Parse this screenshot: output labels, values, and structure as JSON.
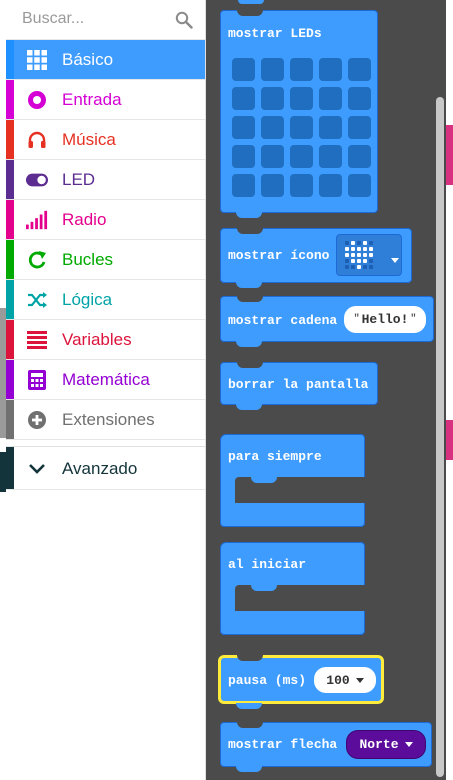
{
  "search": {
    "placeholder": "Buscar..."
  },
  "categories": [
    {
      "label": "Básico",
      "color": "#1e90ff",
      "icon": "grid-icon",
      "active": true
    },
    {
      "label": "Entrada",
      "color": "#d400d4",
      "icon": "target-icon"
    },
    {
      "label": "Música",
      "color": "#e63022",
      "icon": "headphones-icon"
    },
    {
      "label": "LED",
      "color": "#5c2d91",
      "icon": "toggle-icon"
    },
    {
      "label": "Radio",
      "color": "#e3008c",
      "icon": "signal-bars-icon"
    },
    {
      "label": "Bucles",
      "color": "#00aa00",
      "icon": "loop-arrow-icon"
    },
    {
      "label": "Lógica",
      "color": "#00a4a6",
      "icon": "shuffle-icon"
    },
    {
      "label": "Variables",
      "color": "#dc143c",
      "icon": "lines-icon"
    },
    {
      "label": "Matemática",
      "color": "#9400d3",
      "icon": "calculator-icon"
    },
    {
      "label": "Extensiones",
      "color": "#707070",
      "icon": "plus-circle-icon"
    },
    {
      "label": "Avanzado",
      "color": "#13343b",
      "icon": "chevron-down-icon"
    }
  ],
  "blocks": {
    "show_leds": "mostrar LEDs",
    "show_icon": "mostrar ícono",
    "show_string": "mostrar cadena",
    "show_string_value": "Hello!",
    "clear_screen": "borrar la pantalla",
    "forever": "para siempre",
    "on_start": "al iniciar",
    "pause": "pausa (ms)",
    "pause_value": "100",
    "show_arrow": "mostrar flecha",
    "show_arrow_value": "Norte"
  },
  "colors": {
    "block_blue": "#3f9cff",
    "workspace_bg": "#4b4b4b",
    "highlight_yellow": "#ffeb3b",
    "arrow_purple": "#5c0c9b"
  }
}
